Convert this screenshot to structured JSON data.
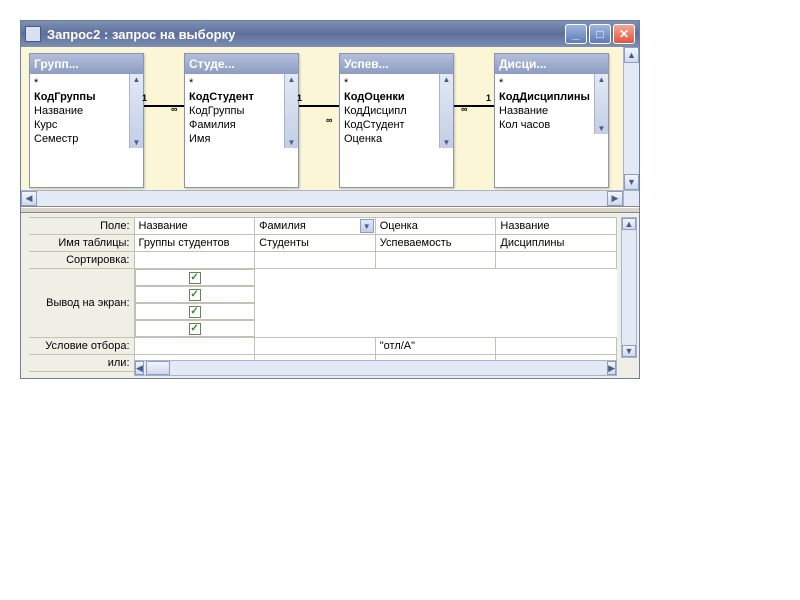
{
  "window": {
    "title": "Запрос2 : запрос на выборку"
  },
  "tables": [
    {
      "title": "Групп...",
      "fields": [
        {
          "name": "*",
          "pk": false
        },
        {
          "name": "КодГруппы",
          "pk": true
        },
        {
          "name": "Название",
          "pk": false
        },
        {
          "name": "Курс",
          "pk": false
        },
        {
          "name": "Семестр",
          "pk": false
        }
      ]
    },
    {
      "title": "Студе...",
      "fields": [
        {
          "name": "*",
          "pk": false
        },
        {
          "name": "КодСтудент",
          "pk": true
        },
        {
          "name": "КодГруппы",
          "pk": false
        },
        {
          "name": "Фамилия",
          "pk": false
        },
        {
          "name": "Имя",
          "pk": false
        }
      ]
    },
    {
      "title": "Успев...",
      "fields": [
        {
          "name": "*",
          "pk": false
        },
        {
          "name": "КодОценки",
          "pk": true
        },
        {
          "name": "КодДисципл",
          "pk": false
        },
        {
          "name": "КодСтудент",
          "pk": false
        },
        {
          "name": "Оценка",
          "pk": false
        }
      ]
    },
    {
      "title": "Дисци...",
      "fields": [
        {
          "name": "*",
          "pk": false
        },
        {
          "name": "КодДисциплины",
          "pk": true
        },
        {
          "name": "Название",
          "pk": false
        },
        {
          "name": "Кол часов",
          "pk": false
        }
      ]
    }
  ],
  "relations": {
    "one": "1",
    "many": "∞"
  },
  "grid_labels": {
    "field": "Поле:",
    "table": "Имя таблицы:",
    "sort": "Сортировка:",
    "show": "Вывод на экран:",
    "criteria": "Условие отбора:",
    "or": "или:"
  },
  "columns": [
    {
      "field": "Название",
      "table": "Группы студентов",
      "sort": "",
      "show": true,
      "criteria": "",
      "or": "",
      "active": false
    },
    {
      "field": "Фамилия",
      "table": "Студенты",
      "sort": "",
      "show": true,
      "criteria": "",
      "or": "",
      "active": true
    },
    {
      "field": "Оценка",
      "table": "Успеваемость",
      "sort": "",
      "show": true,
      "criteria": "\"отл/A\"",
      "or": "",
      "active": false
    },
    {
      "field": "Название",
      "table": "Дисциплины",
      "sort": "",
      "show": true,
      "criteria": "",
      "or": "",
      "active": false
    }
  ]
}
